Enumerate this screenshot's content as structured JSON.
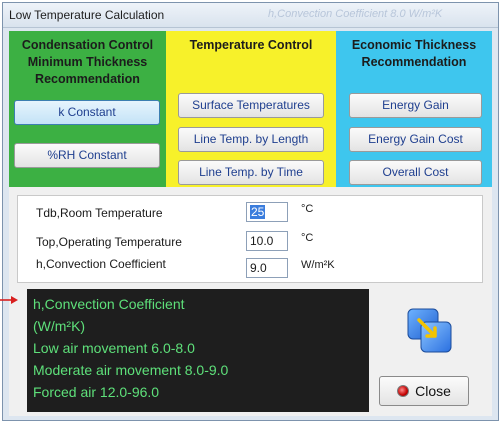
{
  "window": {
    "title": "Low Temperature Calculation",
    "ghost_title": "h,Convection Coefficient 8.0 W/m²K"
  },
  "panels": {
    "condensation": {
      "title_lines": [
        "Condensation Control",
        "Minimum Thickness",
        "Recommendation"
      ],
      "buttons": [
        "k Constant",
        "%RH Constant"
      ],
      "selected": "k Constant",
      "color": "#3cb043"
    },
    "temperature": {
      "title_lines": [
        "Temperature Control"
      ],
      "buttons": [
        "Surface Temperatures",
        "Line Temp. by Length",
        "Line Temp. by Time"
      ],
      "color": "#f7f12a"
    },
    "economic": {
      "title_lines": [
        "Economic Thickness",
        "Recommendation"
      ],
      "buttons": [
        "Energy Gain",
        "Energy Gain Cost",
        "Overall Cost"
      ],
      "color": "#3ec6ee"
    }
  },
  "inputs": {
    "tdb": {
      "label": "Tdb,Room Temperature",
      "value": "25",
      "unit": "°C"
    },
    "top": {
      "label": "Top,Operating Temperature",
      "value": "10.0",
      "unit": "°C"
    },
    "h": {
      "label": "h,Convection Coefficient",
      "value": "9.0",
      "unit": "W/m²K"
    }
  },
  "info_panel": {
    "lines": [
      "h,Convection Coefficient",
      "(W/m²K)",
      "Low air movement  6.0-8.0",
      "Moderate air movement  8.0-9.0",
      "Forced air  12.0-96.0"
    ],
    "text_color": "#5ee07a"
  },
  "actions": {
    "close_label": "Close"
  },
  "icons": {
    "apply": "resize-arrow-icon",
    "close": "close-record-icon",
    "pointer": "pointer-arrow-icon"
  }
}
